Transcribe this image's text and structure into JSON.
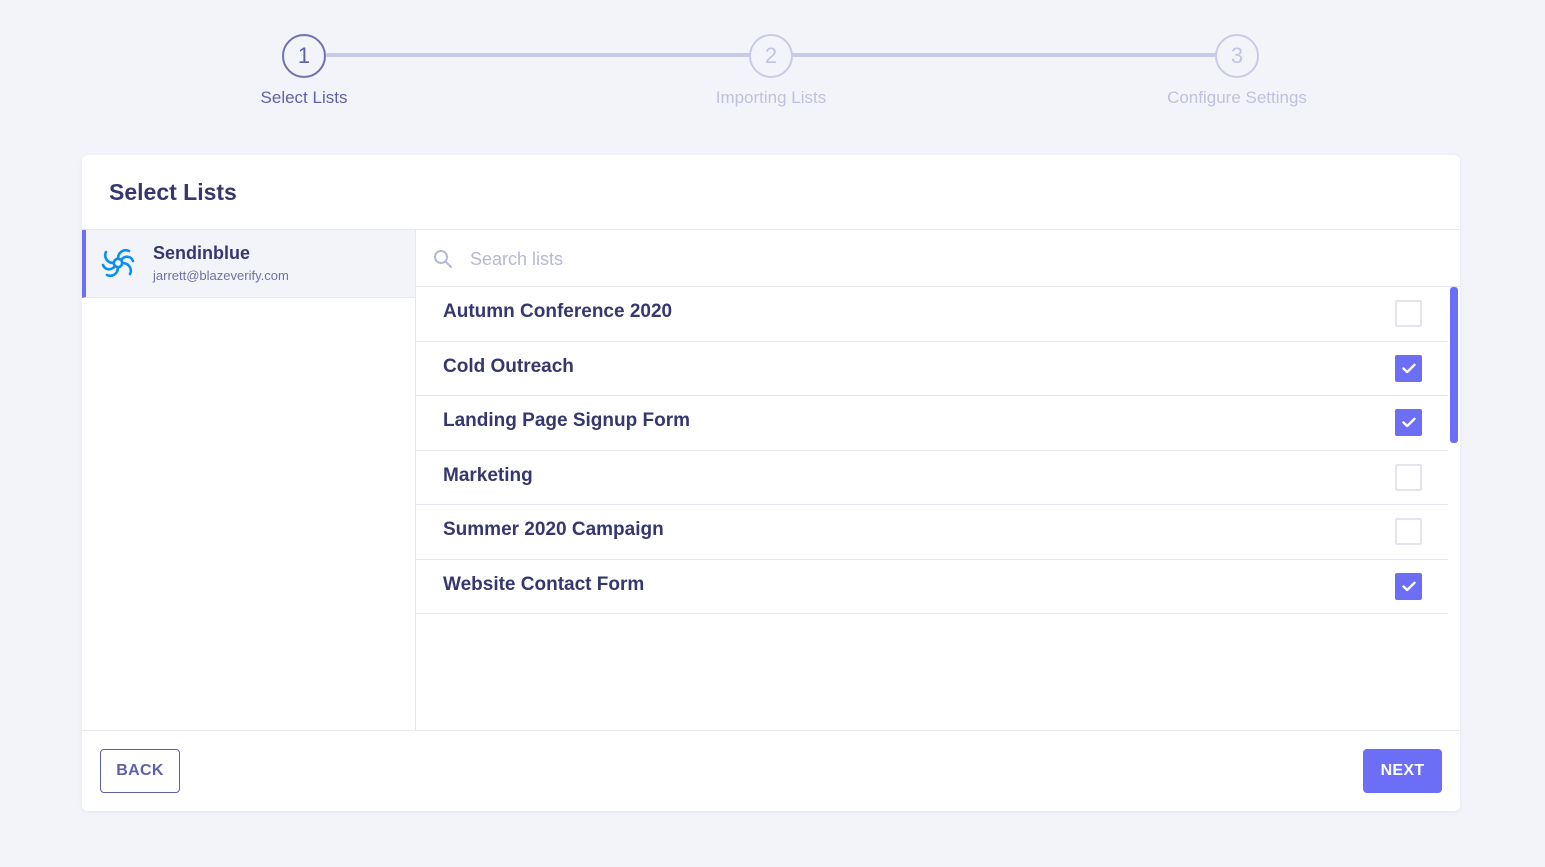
{
  "stepper": {
    "steps": [
      {
        "number": "1",
        "label": "Select Lists",
        "state": "active"
      },
      {
        "number": "2",
        "label": "Importing Lists",
        "state": "inactive"
      },
      {
        "number": "3",
        "label": "Configure Settings",
        "state": "inactive"
      }
    ]
  },
  "card": {
    "title": "Select Lists"
  },
  "account": {
    "name": "Sendinblue",
    "email": "jarrett@blazeverify.com",
    "icon": "sendinblue-logo-icon"
  },
  "search": {
    "placeholder": "Search lists",
    "value": "",
    "icon": "search-icon"
  },
  "lists": [
    {
      "label": "Autumn Conference 2020",
      "checked": false
    },
    {
      "label": "Cold Outreach",
      "checked": true
    },
    {
      "label": "Landing Page Signup Form",
      "checked": true
    },
    {
      "label": "Marketing",
      "checked": false
    },
    {
      "label": "Summer 2020 Campaign",
      "checked": false
    },
    {
      "label": "Website Contact Form",
      "checked": true
    }
  ],
  "footer": {
    "back_label": "BACK",
    "next_label": "NEXT"
  },
  "colors": {
    "accent": "#6c6ff5",
    "text_primary": "#35376e",
    "background": "#f3f4fa",
    "step_active": "#5f61a6",
    "step_inactive": "#c0c1dd"
  }
}
